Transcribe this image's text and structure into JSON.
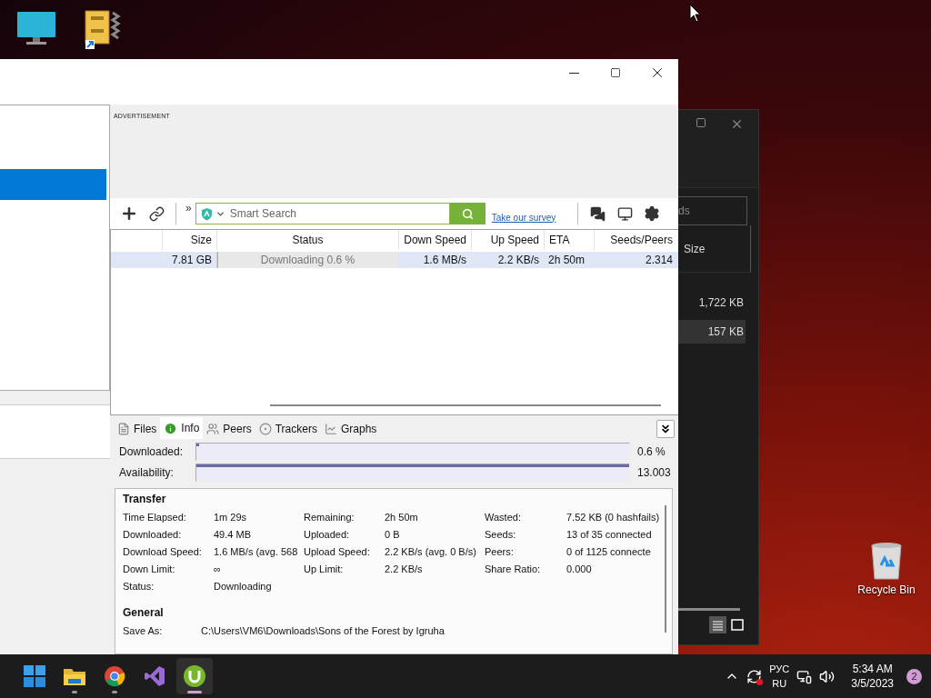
{
  "desktop": {
    "recycle_bin_label": "Recycle Bin"
  },
  "background_window": {
    "search_value": "ds",
    "column": "Size",
    "rows": [
      {
        "size": "1,722 KB",
        "selected": false
      },
      {
        "size": "157 KB",
        "selected": true
      }
    ]
  },
  "app": {
    "sidebar": {
      "items": [
        {
          "selected": true
        }
      ]
    },
    "ad_label": "ADVERTISEMENT",
    "toolbar": {
      "overflow": "»",
      "search_placeholder": "Smart Search",
      "survey_link": "Take our survey"
    },
    "table": {
      "columns": [
        {
          "label": "Size"
        },
        {
          "label": "Status"
        },
        {
          "label": "Down Speed"
        },
        {
          "label": "Up Speed"
        },
        {
          "label": "ETA"
        },
        {
          "label": "Seeds/Peers"
        }
      ],
      "rows": [
        {
          "selected": true,
          "level": 0.006,
          "cells": [
            "7.81 GB",
            "Downloading 0.6 %",
            "1.6 MB/s",
            "2.2 KB/s",
            "2h 50m",
            "2.314"
          ]
        }
      ]
    },
    "detail_tabs": [
      {
        "kind": "files",
        "label": "Files",
        "selected": false
      },
      {
        "kind": "info",
        "label": "Info",
        "selected": true
      },
      {
        "kind": "peers",
        "label": "Peers",
        "selected": false
      },
      {
        "kind": "trackers",
        "label": "Trackers",
        "selected": false
      },
      {
        "kind": "graphs",
        "label": "Graphs",
        "selected": false
      }
    ],
    "bars": [
      {
        "label": "Downloaded:",
        "level": 0.006,
        "reading": "0.6 %"
      },
      {
        "label": "Availability:",
        "level": 1,
        "reading": "13.003"
      }
    ],
    "sections": [
      {
        "title": "Transfer",
        "kind": "triple",
        "fields": [
          {
            "label": "Time Elapsed:",
            "value": "1m 29s"
          },
          {
            "label": "Remaining:",
            "value": "2h 50m"
          },
          {
            "label": "Wasted:",
            "value": "7.52 KB (0 hashfails)"
          },
          {
            "label": "Downloaded:",
            "value": "49.4 MB"
          },
          {
            "label": "Uploaded:",
            "value": "0 B"
          },
          {
            "label": "Seeds:",
            "value": "13 of 35 connected"
          },
          {
            "label": "Download Speed:",
            "value": "1.6 MB/s (avg. 568"
          },
          {
            "label": "Upload Speed:",
            "value": "2.2 KB/s (avg. 0 B/s)"
          },
          {
            "label": "Peers:",
            "value": "0 of 1125 connecte"
          },
          {
            "label": "Down Limit:",
            "value": "∞"
          },
          {
            "label": "Up Limit:",
            "value": "2.2 KB/s"
          },
          {
            "label": "Share Ratio:",
            "value": "0.000"
          },
          {
            "label": "Status:",
            "value": "Downloading"
          }
        ]
      },
      {
        "title": "General",
        "kind": "single",
        "fields": [
          {
            "label": "Save As:",
            "value": "C:\\Users\\VM6\\Downloads\\Sons of the Forest by Igruha"
          }
        ]
      }
    ]
  },
  "taskbar": {
    "apps": [
      {
        "kind": "start",
        "running": false,
        "selected": false
      },
      {
        "kind": "folder",
        "running": true,
        "selected": false
      },
      {
        "kind": "chrome",
        "running": true,
        "selected": false
      },
      {
        "kind": "studio",
        "running": false,
        "selected": false
      },
      {
        "kind": "torrent",
        "running": true,
        "selected": true
      }
    ],
    "lang_top": "РУС",
    "lang_bottom": "RU",
    "time": "5:34 AM",
    "date": "3/5/2023",
    "notifications": "2"
  }
}
